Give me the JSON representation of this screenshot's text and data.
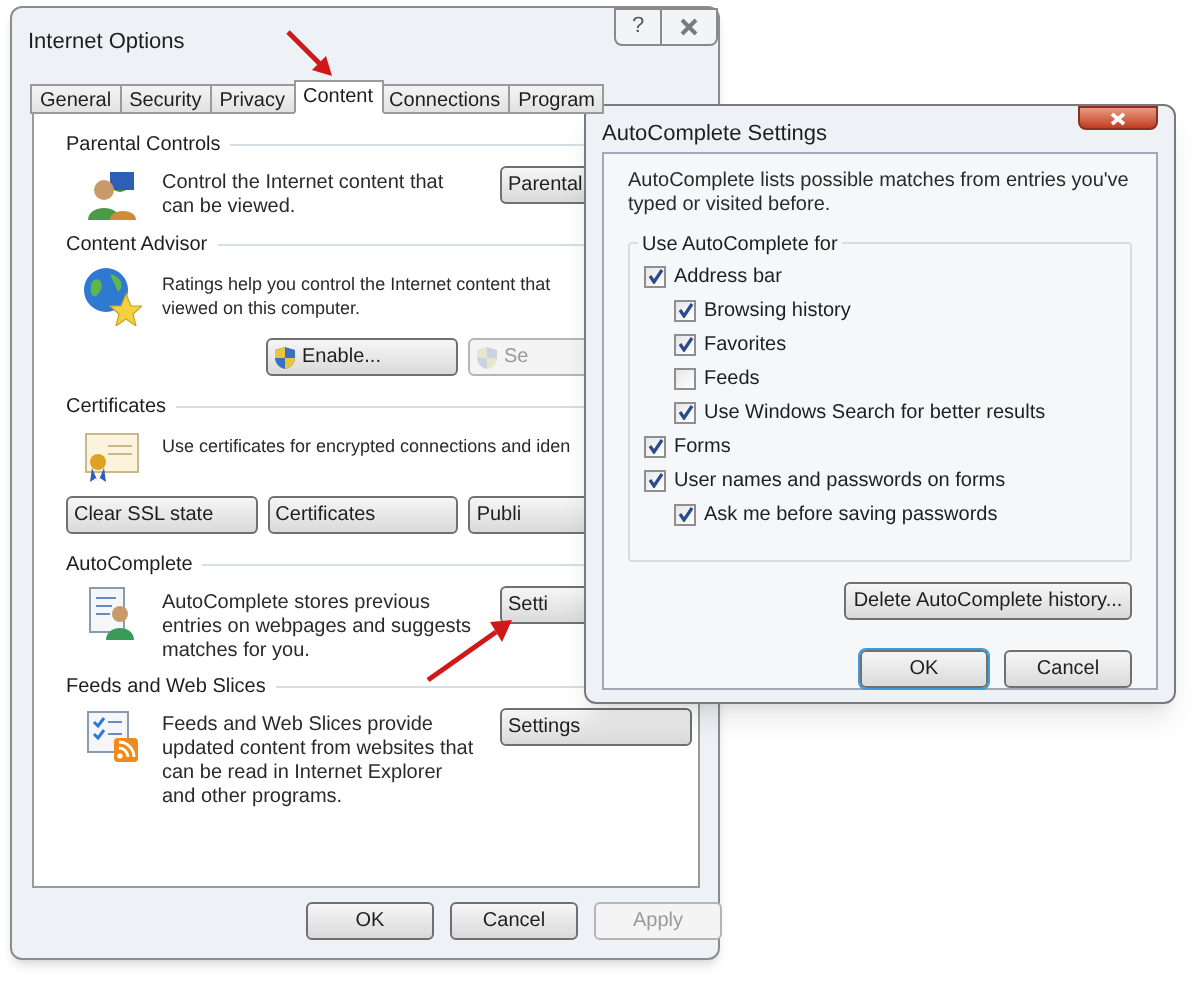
{
  "main_window": {
    "title": "Internet Options",
    "help": "?",
    "tabs": [
      {
        "label": "General",
        "selected": false
      },
      {
        "label": "Security",
        "selected": false
      },
      {
        "label": "Privacy",
        "selected": false
      },
      {
        "label": "Content",
        "selected": true
      },
      {
        "label": "Connections",
        "selected": false
      },
      {
        "label": "Program",
        "selected": false
      }
    ],
    "sections": [
      {
        "title": "Parental Controls",
        "kind": "side",
        "description": "Control the Internet content that can be viewed.",
        "buttons": [
          {
            "label": "Parental",
            "disabled": false,
            "kind": "plain"
          }
        ]
      },
      {
        "title": "Content Advisor",
        "kind": "below",
        "description": "Ratings help you control the Internet content that viewed on this computer.",
        "buttons": [
          {
            "label": "Enable...",
            "disabled": false,
            "kind": "shield"
          },
          {
            "label": "Se",
            "disabled": true,
            "kind": "shield"
          }
        ]
      },
      {
        "title": "Certificates",
        "kind": "below",
        "description": "Use certificates for encrypted connections and iden",
        "buttons": [
          {
            "label": "Clear SSL state",
            "disabled": false,
            "kind": "plain"
          },
          {
            "label": "Certificates",
            "disabled": false,
            "kind": "plain"
          },
          {
            "label": "Publi",
            "disabled": false,
            "kind": "plain"
          }
        ]
      },
      {
        "title": "AutoComplete",
        "kind": "side",
        "description": "AutoComplete stores previous entries on webpages and suggests matches for you.",
        "buttons": [
          {
            "label": "Setti",
            "disabled": false,
            "kind": "plain"
          }
        ]
      },
      {
        "title": "Feeds and Web Slices",
        "kind": "side",
        "description": "Feeds and Web Slices provide updated content from websites that can be read in Internet Explorer and other programs.",
        "buttons": [
          {
            "label": "Settings",
            "disabled": false,
            "kind": "plain"
          }
        ]
      }
    ],
    "footer_buttons": [
      {
        "label": "OK",
        "disabled": false
      },
      {
        "label": "Cancel",
        "disabled": false
      },
      {
        "label": "Apply",
        "disabled": true
      }
    ]
  },
  "autocomplete_dialog": {
    "title": "AutoComplete Settings",
    "description": "AutoComplete lists possible matches from entries you've typed or visited before.",
    "group_title": "Use AutoComplete for",
    "options": [
      {
        "label": "Address bar",
        "checked": true,
        "children": [
          {
            "label": "Browsing history",
            "checked": true
          },
          {
            "label": "Favorites",
            "checked": true
          },
          {
            "label": "Feeds",
            "checked": false
          },
          {
            "label": "Use Windows Search for better results",
            "checked": true
          }
        ]
      },
      {
        "label": "Forms",
        "checked": true
      },
      {
        "label": "User names and passwords on forms",
        "checked": true,
        "children": [
          {
            "label": "Ask me before saving passwords",
            "checked": true
          }
        ]
      }
    ],
    "delete_button": "Delete AutoComplete history...",
    "buttons": [
      {
        "label": "OK",
        "disabled": false,
        "default": true
      },
      {
        "label": "Cancel",
        "disabled": false,
        "default": false
      }
    ]
  }
}
